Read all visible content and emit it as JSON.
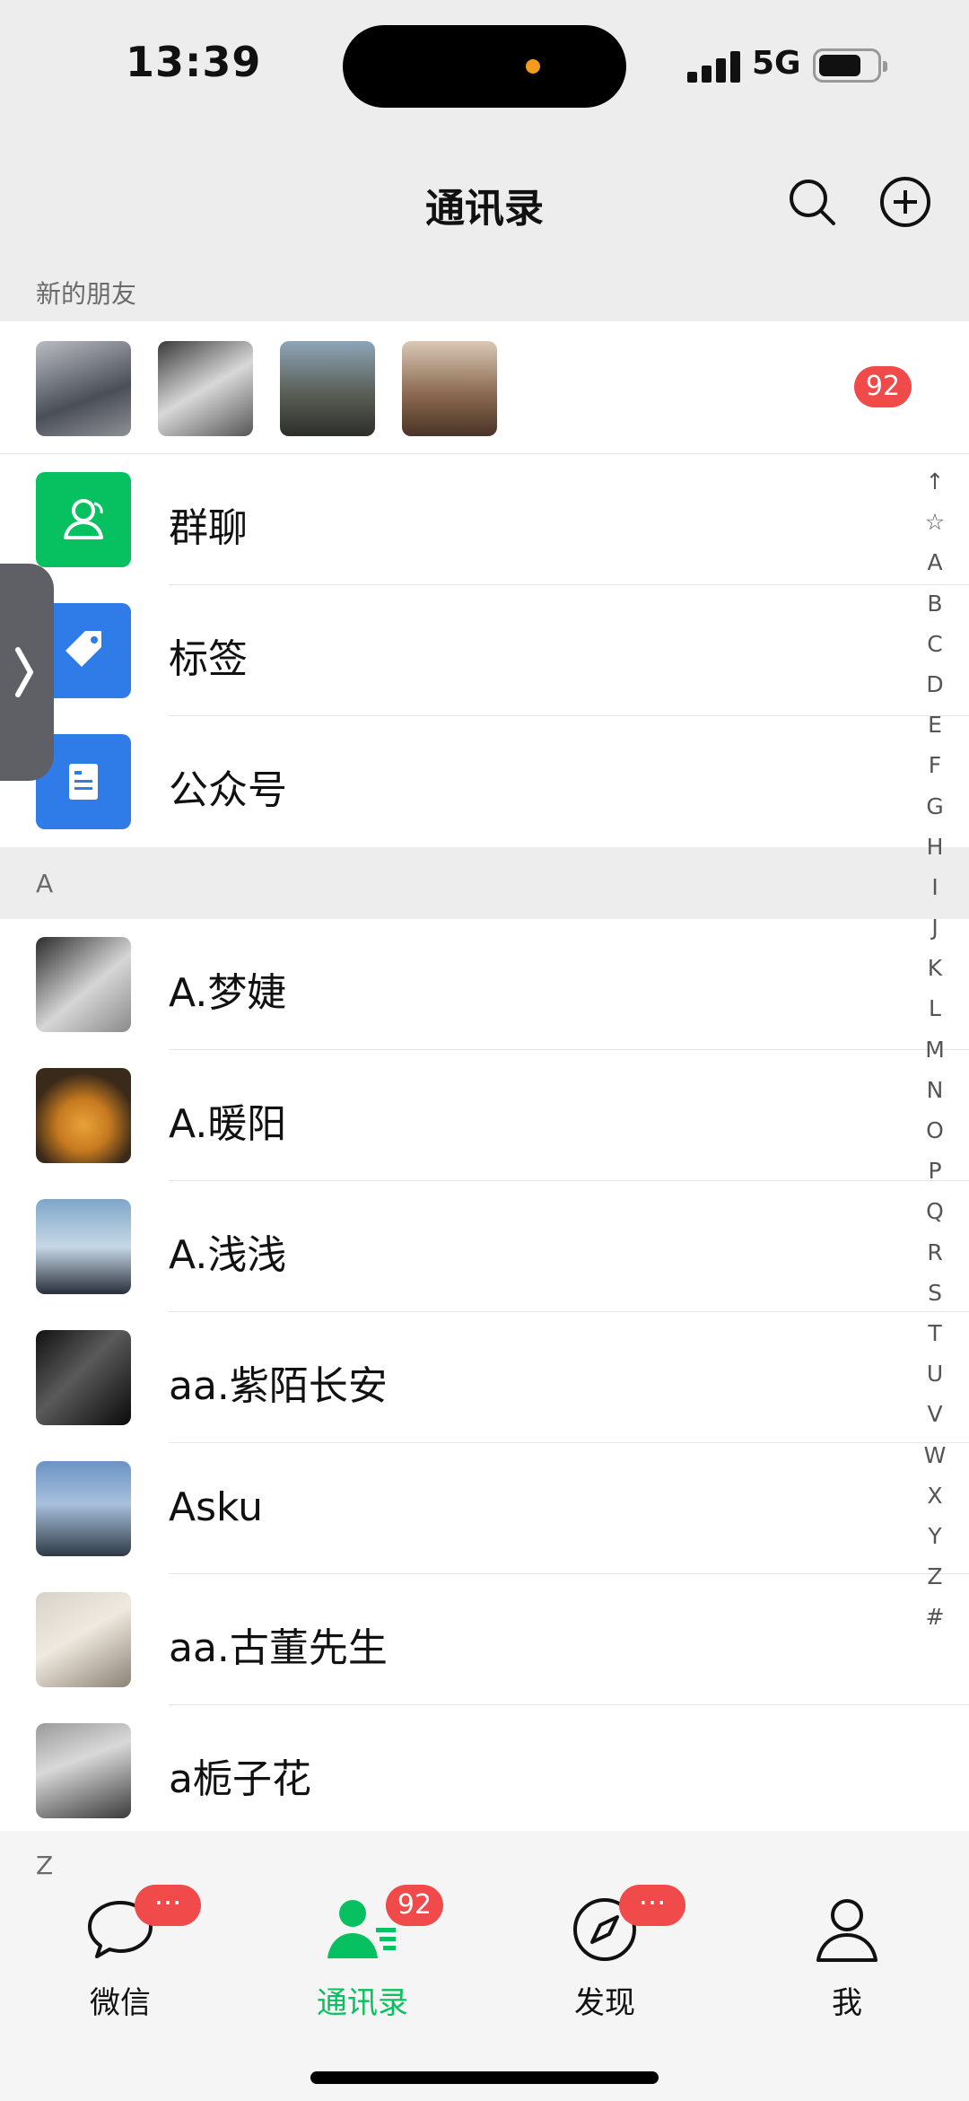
{
  "status_bar": {
    "time": "13:39",
    "network": "5G"
  },
  "nav": {
    "title": "通讯录"
  },
  "new_friends": {
    "label": "新的朋友",
    "badge": "92"
  },
  "functions": [
    {
      "label": "群聊",
      "icon": "group-chat-icon",
      "color": "#07c160"
    },
    {
      "label": "标签",
      "icon": "tag-icon",
      "color": "#2f7be8"
    },
    {
      "label": "公众号",
      "icon": "official-account-icon",
      "color": "#2f7be8"
    }
  ],
  "section_a": {
    "letter": "A"
  },
  "contacts": [
    {
      "name": "A.梦婕"
    },
    {
      "name": "A.暖阳"
    },
    {
      "name": "A.浅浅"
    },
    {
      "name": "aa.紫陌长安"
    },
    {
      "name": "Asku"
    },
    {
      "name": "aa.古董先生"
    },
    {
      "name": "a栀子花"
    }
  ],
  "section_z": {
    "letter": "Z"
  },
  "index_letters": [
    "↑",
    "☆",
    "A",
    "B",
    "C",
    "D",
    "E",
    "F",
    "G",
    "H",
    "I",
    "J",
    "K",
    "L",
    "M",
    "N",
    "O",
    "P",
    "Q",
    "R",
    "S",
    "T",
    "U",
    "V",
    "W",
    "X",
    "Y",
    "Z",
    "#"
  ],
  "tabs": [
    {
      "label": "微信",
      "badge": "···",
      "icon": "chat-bubble-icon"
    },
    {
      "label": "通讯录",
      "badge": "92",
      "icon": "contacts-icon",
      "active": true
    },
    {
      "label": "发现",
      "badge": "···",
      "icon": "compass-icon"
    },
    {
      "label": "我",
      "badge": "",
      "icon": "person-icon"
    }
  ],
  "colors": {
    "accent": "#07c160",
    "badge": "#f04a4a",
    "blue": "#2f7be8"
  }
}
